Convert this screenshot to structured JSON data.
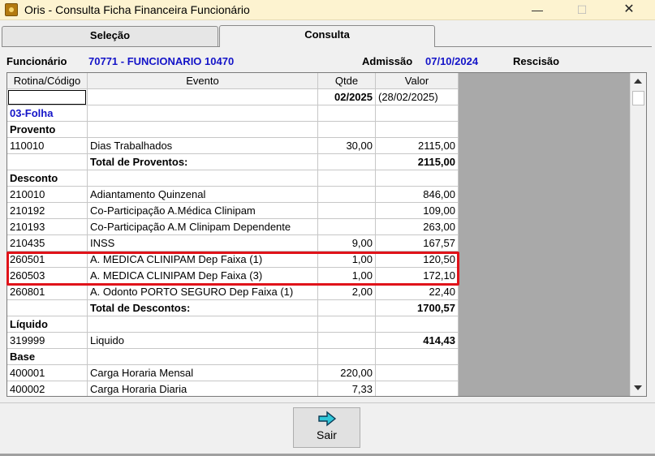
{
  "window": {
    "title": "Oris - Consulta Ficha Financeira Funcionário",
    "minimize_glyph": "—",
    "maximize_glyph": "☐",
    "close_glyph": "✕"
  },
  "tabs": [
    {
      "label": "Seleção",
      "active": false
    },
    {
      "label": "Consulta",
      "active": true
    }
  ],
  "employee": {
    "funcionario_label": "Funcionário",
    "funcionario_value": "70771 - FUNCIONARIO 10470",
    "admissao_label": "Admissão",
    "admissao_value": "07/10/2024",
    "rescisao_label": "Rescisão"
  },
  "grid": {
    "headers": [
      "Rotina/Código",
      "Evento",
      "Qtde",
      "Valor"
    ],
    "period": {
      "qtde": "02/2025",
      "valor": "(28/02/2025)"
    },
    "rows": [
      {
        "code": "03-Folha",
        "event": "",
        "qtde": "",
        "valor": "",
        "style": "section-blue"
      },
      {
        "code": "Provento",
        "event": "",
        "qtde": "",
        "valor": "",
        "style": "section"
      },
      {
        "code": "110010",
        "event": "Dias Trabalhados",
        "qtde": "30,00",
        "valor": "2115,00",
        "style": ""
      },
      {
        "code": "",
        "event": "Total de Proventos:",
        "qtde": "",
        "valor": "2115,00",
        "style": "total"
      },
      {
        "code": "Desconto",
        "event": "",
        "qtde": "",
        "valor": "",
        "style": "section"
      },
      {
        "code": "210010",
        "event": "Adiantamento Quinzenal",
        "qtde": "",
        "valor": "846,00",
        "style": ""
      },
      {
        "code": "210192",
        "event": "Co-Participação A.Médica Clinipam",
        "qtde": "",
        "valor": "109,00",
        "style": ""
      },
      {
        "code": "210193",
        "event": "Co-Participação A.M Clinipam Dependente",
        "qtde": "",
        "valor": "263,00",
        "style": ""
      },
      {
        "code": "210435",
        "event": "INSS",
        "qtde": "9,00",
        "valor": "167,57",
        "style": ""
      },
      {
        "code": "260501",
        "event": "A. MEDICA CLINIPAM Dep Faixa (1)",
        "qtde": "1,00",
        "valor": "120,50",
        "style": ""
      },
      {
        "code": "260503",
        "event": "A. MEDICA CLINIPAM Dep Faixa (3)",
        "qtde": "1,00",
        "valor": "172,10",
        "style": ""
      },
      {
        "code": "260801",
        "event": "A. Odonto PORTO SEGURO Dep Faixa (1)",
        "qtde": "2,00",
        "valor": "22,40",
        "style": ""
      },
      {
        "code": "",
        "event": "Total de Descontos:",
        "qtde": "",
        "valor": "1700,57",
        "style": "total"
      },
      {
        "code": "Líquido",
        "event": "",
        "qtde": "",
        "valor": "",
        "style": "section"
      },
      {
        "code": "319999",
        "event": "Liquido",
        "qtde": "",
        "valor": "414,43",
        "style": "bold-valor"
      },
      {
        "code": "Base",
        "event": "",
        "qtde": "",
        "valor": "",
        "style": "section"
      },
      {
        "code": "400001",
        "event": "Carga Horaria Mensal",
        "qtde": "220,00",
        "valor": "",
        "style": ""
      },
      {
        "code": "400002",
        "event": "Carga Horaria Diaria",
        "qtde": "7,33",
        "valor": "",
        "style": ""
      }
    ]
  },
  "buttons": {
    "sair_label": "Sair",
    "sair_icon": "arrow-right-icon"
  },
  "colors": {
    "title_bar": "#fdf3d0",
    "value_blue": "#1414c8",
    "highlight_red": "#e0131a",
    "arrow_cyan": "#2fc6d8"
  }
}
